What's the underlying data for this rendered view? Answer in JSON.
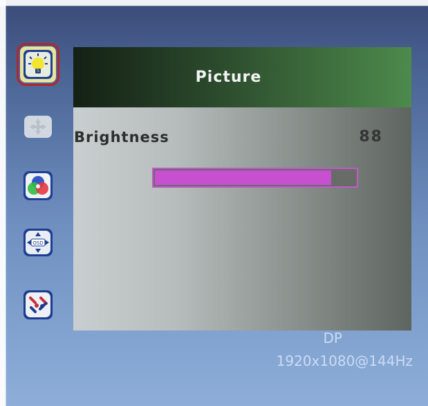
{
  "menu": {
    "title": "Picture",
    "items": [
      {
        "name": "picture",
        "icon": "lightbulb-icon",
        "selected": true
      },
      {
        "name": "position",
        "icon": "move-icon",
        "selected": false
      },
      {
        "name": "color",
        "icon": "color-circles-icon",
        "selected": false
      },
      {
        "name": "osd",
        "icon": "osd-icon",
        "selected": false
      },
      {
        "name": "setup",
        "icon": "tools-icon",
        "selected": false
      }
    ]
  },
  "setting": {
    "label": "Brightness",
    "value": "88",
    "level_percent": 88
  },
  "signal": {
    "input": "DP",
    "resolution": "1920x1080@144Hz"
  },
  "colors": {
    "highlight": "#b3262d",
    "slider_fill": "#c750d1",
    "slider_border": "#c25ac9"
  }
}
